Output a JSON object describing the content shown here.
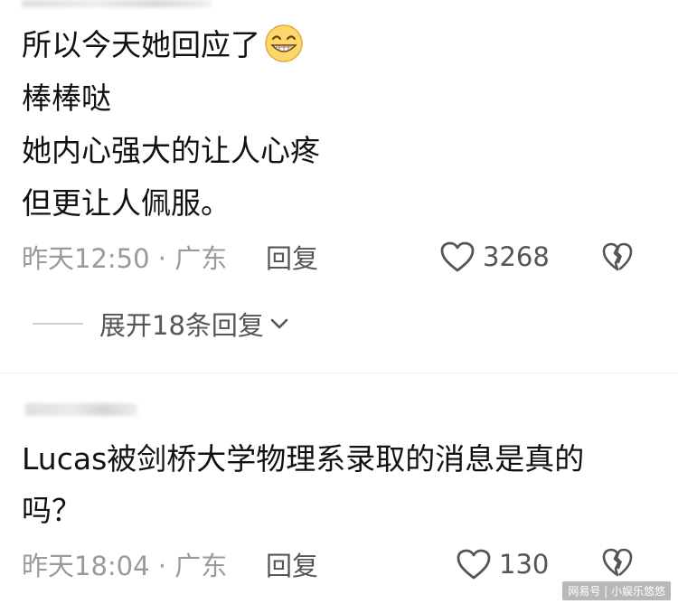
{
  "comments": [
    {
      "lines": [
        "所以今天她回应了",
        "棒棒哒",
        "她内心强大的让人心疼",
        "但更让人佩服。"
      ],
      "emoji": "grinning-face-emoji",
      "time_location": "昨天12:50 · 广东",
      "reply_label": "回复",
      "likes": "3268"
    },
    {
      "lines": [
        "Lucas被剑桥大学物理系录取的消息是真的",
        "吗？"
      ],
      "time_location": "昨天18:04 · 广东",
      "reply_label": "回复",
      "likes": "130"
    }
  ],
  "expand_replies": "展开18条回复",
  "watermark": "网易号 | 小娱乐悠悠",
  "icons": {
    "like": "heart-outline-icon",
    "dislike": "broken-heart-icon",
    "expand": "chevron-down-icon"
  },
  "colors": {
    "text": "#111111",
    "meta": "#9a9a9a",
    "secondary": "#555555"
  }
}
